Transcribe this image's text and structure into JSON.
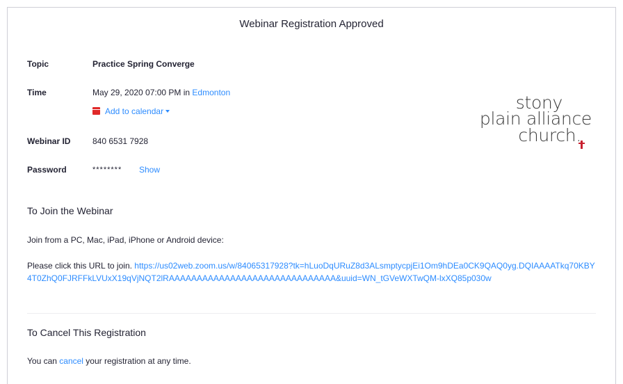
{
  "header": {
    "title": "Webinar Registration Approved"
  },
  "details": {
    "topic_label": "Topic",
    "topic_value": "Practice Spring Converge",
    "time_label": "Time",
    "time_value": "May 29, 2020 07:00 PM in ",
    "time_zone_link": "Edmonton",
    "add_to_calendar": "Add to calendar",
    "webinar_id_label": "Webinar ID",
    "webinar_id_value": "840 6531 7928",
    "password_label": "Password",
    "password_value": "********",
    "show_link": "Show"
  },
  "logo": {
    "line1": "stony",
    "line2": "plain alliance",
    "line3": "church."
  },
  "join": {
    "title": "To Join the Webinar",
    "devices_text": "Join from a PC, Mac, iPad, iPhone or Android device:",
    "url_prefix": "Please click this URL to join. ",
    "url": "https://us02web.zoom.us/w/84065317928?tk=hLuoDqURuZ8d3ALsmptycpjEi1Om9hDEa0CK9QAQ0yg.DQIAAAATkq70KBY4T0ZhQ0FJRFFkLVUxX19qVjNQT2lRAAAAAAAAAAAAAAAAAAAAAAAAAAAAAA&uuid=WN_tGVeWXTwQM-lxXQ85p030w"
  },
  "cancel": {
    "title": "To Cancel This Registration",
    "text_before": "You can ",
    "link": "cancel",
    "text_after": " your registration at any time."
  },
  "colors": {
    "link": "#2d8cff",
    "calendar_icon": "#e02828",
    "logo_cross": "#c8202f",
    "text": "#232333"
  },
  "icons": {
    "calendar": "calendar-icon",
    "dropdown": "caret-down-icon",
    "logo_mark": "cross-icon"
  }
}
